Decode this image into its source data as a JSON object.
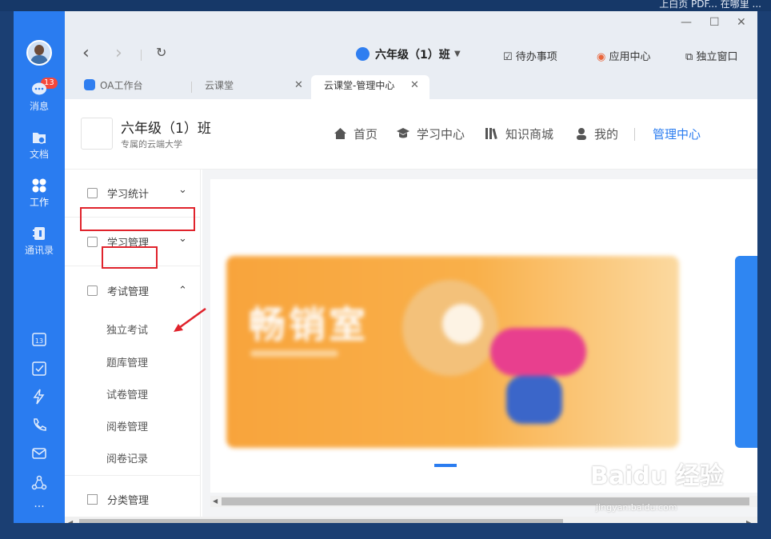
{
  "desktop": {
    "top_text": "上白页 PDF...   在哪里 ..."
  },
  "rail": {
    "badge": "13",
    "items": [
      {
        "label": "消息",
        "icon": "message-icon"
      },
      {
        "label": "文档",
        "icon": "folder-icon"
      },
      {
        "label": "工作",
        "icon": "apps-icon"
      },
      {
        "label": "通讯录",
        "icon": "contacts-icon"
      }
    ],
    "calendar_day": "13"
  },
  "window_controls": {
    "minimize": "—",
    "maximize": "☐",
    "close": "✕"
  },
  "toolbar": {
    "back": "‹",
    "forward": "›",
    "refresh": "↻",
    "class_title": "六年级（1）班",
    "todo": "待办事项",
    "app_center": "应用中心",
    "standalone": "独立窗口"
  },
  "tabs": [
    {
      "label": "OA工作台"
    },
    {
      "label": "云课堂",
      "close": "✕"
    },
    {
      "label": "云课堂-管理中心",
      "close": "✕"
    }
  ],
  "site": {
    "title": "六年级（1）班",
    "subtitle": "专属的云端大学",
    "nav": [
      "首页",
      "学习中心",
      "知识商城",
      "我的",
      "管理中心"
    ]
  },
  "sidebar": {
    "items": [
      {
        "label": "学习统计",
        "chev": "⌄"
      },
      {
        "label": "学习管理",
        "chev": "⌄"
      },
      {
        "label": "考试管理",
        "chev": "⌃"
      }
    ],
    "sub_items": [
      "独立考试",
      "题库管理",
      "试卷管理",
      "阅卷管理",
      "阅卷记录"
    ],
    "last_item": "分类管理"
  },
  "banner": {
    "text": "畅销室"
  },
  "watermark": {
    "text": "Baidu 经验",
    "sub": "jingyan.baidu.com"
  },
  "colors": {
    "accent": "#2a7cf0",
    "highlight": "#e0232c",
    "rail": "#2a7cf0"
  }
}
